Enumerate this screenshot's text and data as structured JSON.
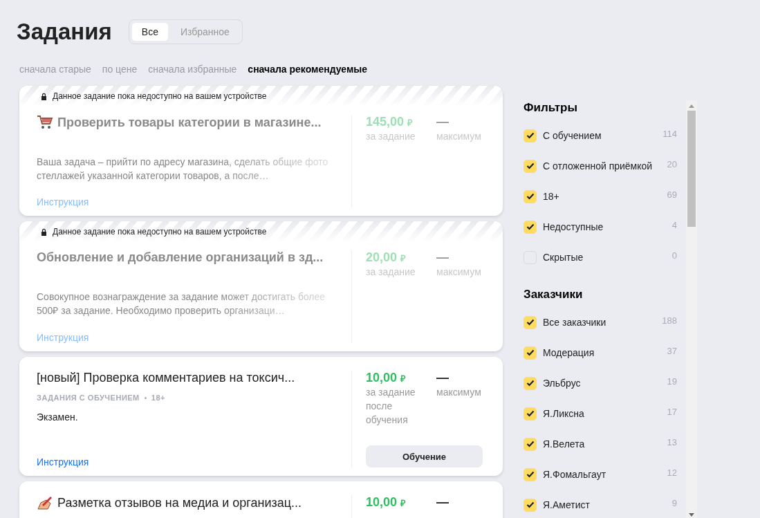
{
  "header": {
    "title": "Задания",
    "tabs": [
      {
        "label": "Все",
        "selected": true
      },
      {
        "label": "Избранное",
        "selected": false
      }
    ]
  },
  "sort_options": [
    {
      "label": "сначала старые",
      "selected": false
    },
    {
      "label": "по цене",
      "selected": false
    },
    {
      "label": "сначала избранные",
      "selected": false
    },
    {
      "label": "сначала рекомендуемые",
      "selected": true
    }
  ],
  "tasks": [
    {
      "unavailable": true,
      "notice": "Данное задание пока недоступно на вашем устройстве",
      "kind": "cart",
      "title": "Проверить товары категории в магазине...",
      "price": "145,00",
      "currency": "₽",
      "price_label": "за задание",
      "max_value": "—",
      "max_label": "максимум",
      "description": "Ваша задача – прийти по адресу магазина, сделать общие фото стеллажей указанной категории товаров, а после…",
      "link": "Инструкция"
    },
    {
      "unavailable": true,
      "notice": "Данное задание пока недоступно на вашем устройстве",
      "title": "Обновление и добавление организаций в зд...",
      "price": "20,00",
      "currency": "₽",
      "price_label": "за задание",
      "max_value": "—",
      "max_label": "максимум",
      "description": "Совокупное вознаграждение за задание может достигать более 500₽ за задание. Необходимо проверить организаци…",
      "link": "Инструкция"
    },
    {
      "unavailable": false,
      "title": "[новый] Проверка комментариев на токсич...",
      "tags": [
        "ЗАДАНИЯ С ОБУЧЕНИЕМ",
        "18+"
      ],
      "price": "10,00",
      "currency": "₽",
      "price_label": "за задание после обучения",
      "max_value": "—",
      "max_label": "максимум",
      "description": "Экзамен.",
      "link": "Инструкция",
      "button": "Обучение"
    },
    {
      "unavailable": false,
      "kind": "pencil",
      "title": "Разметка отзывов на медиа и организац...",
      "price": "10,00",
      "currency": "₽",
      "max_value": "—"
    }
  ],
  "sidebar": {
    "sections": [
      {
        "title": "Фильтры",
        "items": [
          {
            "label": "С обучением",
            "count": "114",
            "checked": true
          },
          {
            "label": "С отложенной приёмкой",
            "count": "20",
            "checked": true
          },
          {
            "label": "18+",
            "count": "69",
            "checked": true
          },
          {
            "label": "Недоступные",
            "count": "4",
            "checked": true
          },
          {
            "label": "Скрытые",
            "count": "0",
            "checked": false
          }
        ]
      },
      {
        "title": "Заказчики",
        "items": [
          {
            "label": "Все заказчики",
            "count": "188",
            "checked": true
          },
          {
            "label": "Модерация",
            "count": "37",
            "checked": true
          },
          {
            "label": "Эльбрус",
            "count": "19",
            "checked": true
          },
          {
            "label": "Я.Ликсна",
            "count": "17",
            "checked": true
          },
          {
            "label": "Я.Велета",
            "count": "13",
            "checked": true
          },
          {
            "label": "Я.Фомальгаут",
            "count": "12",
            "checked": true
          },
          {
            "label": "Я.Аметист",
            "count": "9",
            "checked": true
          }
        ]
      }
    ]
  }
}
